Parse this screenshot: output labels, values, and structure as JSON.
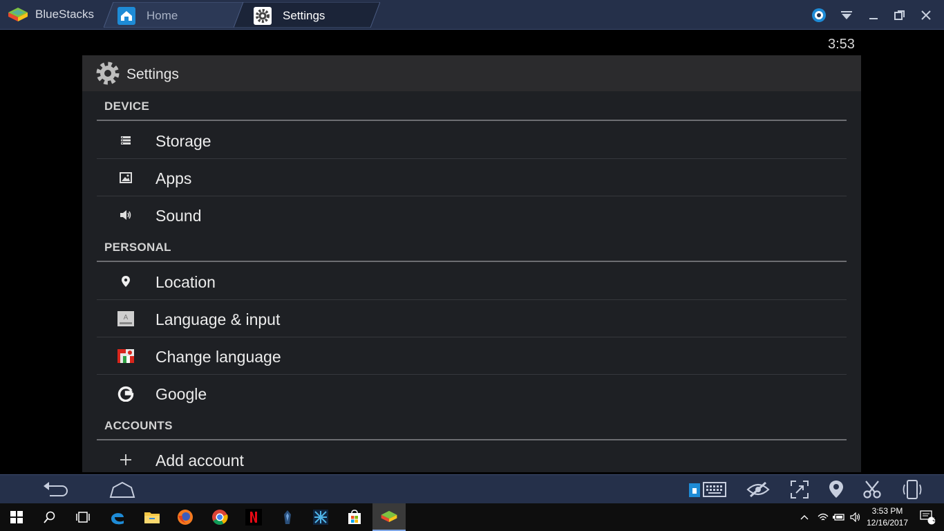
{
  "window": {
    "app_name": "BlueStacks",
    "tabs": [
      {
        "label": "Home",
        "icon": "home-icon"
      },
      {
        "label": "Settings",
        "icon": "gear-icon"
      }
    ],
    "controls": [
      "account-icon",
      "dropdown-icon",
      "minimize-icon",
      "restore-icon",
      "close-icon"
    ]
  },
  "android": {
    "status_time": "3:53",
    "action_bar": {
      "title": "Settings",
      "icon": "gear-icon"
    },
    "sections": [
      {
        "label": "DEVICE",
        "items": [
          {
            "label": "Storage",
            "icon": "storage-icon"
          },
          {
            "label": "Apps",
            "icon": "apps-icon"
          },
          {
            "label": "Sound",
            "icon": "speaker-icon"
          }
        ]
      },
      {
        "label": "PERSONAL",
        "items": [
          {
            "label": "Location",
            "icon": "location-pin-icon"
          },
          {
            "label": "Language & input",
            "icon": "keyboard-icon"
          },
          {
            "label": "Change language",
            "icon": "flags-icon"
          },
          {
            "label": "Google",
            "icon": "google-g-icon"
          }
        ]
      },
      {
        "label": "ACCOUNTS",
        "items": [
          {
            "label": "Add account",
            "icon": "plus-icon"
          }
        ]
      }
    ]
  },
  "bottom_bar": {
    "nav": [
      "back-icon",
      "home-icon"
    ],
    "tools": [
      "keyboard-icon",
      "eye-hidden-icon",
      "fullscreen-icon",
      "location-icon",
      "scissors-icon",
      "rotate-device-icon"
    ]
  },
  "taskbar": {
    "apps": [
      "windows-start-icon",
      "search-icon",
      "task-view-icon",
      "edge-icon",
      "file-explorer-icon",
      "firefox-icon",
      "chrome-icon",
      "netflix-icon",
      "app-icon",
      "app2-icon",
      "store-icon",
      "bluestacks-icon"
    ],
    "time": "3:53 PM",
    "date": "12/16/2017",
    "notification_count": "3"
  },
  "colors": {
    "bluestacks_bar": "#25304a",
    "android_panel": "#1e2024",
    "action_bar": "#2b2b2d",
    "accent": "#1e8bd6"
  }
}
